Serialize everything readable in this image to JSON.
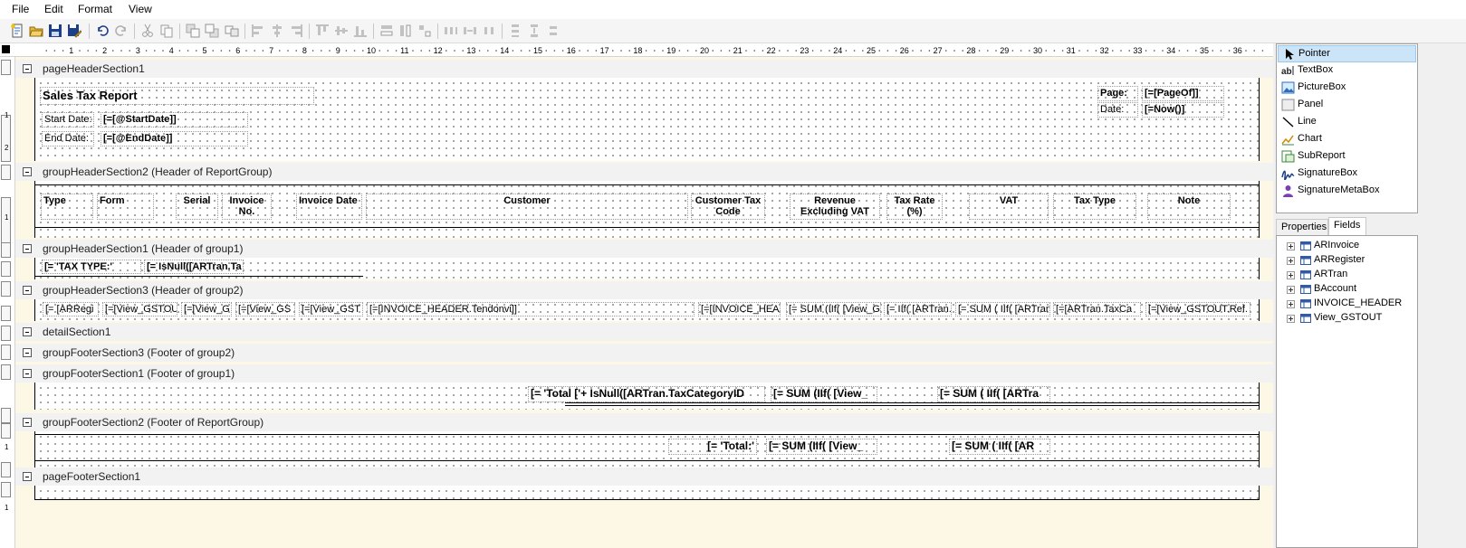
{
  "menu": [
    "File",
    "Edit",
    "Format",
    "View"
  ],
  "toolbar_icons": [
    "new-report-icon",
    "open-folder-icon",
    "save-icon",
    "save-as-icon",
    "undo-icon",
    "redo-icon",
    "cut-icon",
    "copy-icon",
    "bring-to-front-icon",
    "send-to-back-icon",
    "group-icon",
    "align-left-icon",
    "align-center-icon",
    "align-right-icon",
    "align-top-icon",
    "align-middle-icon",
    "align-bottom-icon",
    "same-width-icon",
    "same-height-icon",
    "same-size-icon",
    "horizontal-spacing-equal-icon",
    "horizontal-spacing-increase-icon",
    "horizontal-spacing-decrease-icon",
    "vertical-spacing-equal-icon",
    "vertical-spacing-increase-icon",
    "vertical-spacing-decrease-icon"
  ],
  "ruler": {
    "h_marks": [
      "1",
      "2",
      "3",
      "4",
      "5",
      "6",
      "7",
      "8",
      "9",
      "10",
      "11",
      "12",
      "13",
      "14",
      "15",
      "16",
      "17",
      "18",
      "19",
      "20",
      "21",
      "22",
      "23",
      "24",
      "25",
      "26",
      "27",
      "28",
      "29",
      "30",
      "31",
      "32",
      "33",
      "34",
      "35",
      "36"
    ],
    "v_marks": [
      "1",
      "2",
      "1",
      "1",
      "1"
    ]
  },
  "bands": {
    "page_header": "pageHeaderSection1",
    "group_header_2": "groupHeaderSection2 (Header of ReportGroup)",
    "group_header_1": "groupHeaderSection1 (Header of group1)",
    "group_header_3": "groupHeaderSection3 (Header of group2)",
    "detail": "detailSection1",
    "group_footer_3": "groupFooterSection3 (Footer of group2)",
    "group_footer_1": "groupFooterSection1 (Footer of group1)",
    "group_footer_2": "groupFooterSection2 (Footer of ReportGroup)",
    "page_footer": "pageFooterSection1"
  },
  "page_header": {
    "title": "Sales Tax Report",
    "start_label": "Start Date:",
    "start_value": "[=[@StartDate]]",
    "end_label": "End Date:",
    "end_value": "[=[@EndDate]]",
    "page_label": "Page:",
    "page_value": "[=[PageOf]]",
    "date_label": "Date:",
    "date_value": "[=Now()]"
  },
  "columns": {
    "type": "Type",
    "form": "Form",
    "serial": "Serial",
    "invoice_no_1": "Invoice",
    "invoice_no_2": "No.",
    "invoice_date": "Invoice Date",
    "customer": "Customer",
    "customer_tax_1": "Customer Tax",
    "customer_tax_2": "Code",
    "revenue_1": "Revenue",
    "revenue_2": "Excluding VAT",
    "tax_rate_1": "Tax Rate",
    "tax_rate_2": "(%)",
    "vat": "VAT",
    "tax_type": "Tax Type",
    "note": "Note"
  },
  "group1_header": {
    "tax_type": "[= 'TAX TYPE:'",
    "isnull": "[= IsNull([ARTran.Ta"
  },
  "group2_header_fields": [
    "[= [ARRegi",
    "[=[View_GSTOU",
    "[=[View_G",
    "[=[View_GS",
    "[=[View_GST",
    "[=[INVOICE_HEADER.Tendonvi]]",
    "[=[INVOICE_HEA",
    "[= SUM (IIf( [View_G",
    "[= IIf( [ARTran.",
    "[= SUM ( IIf( [ARTran",
    "[=[ARTran.TaxCa",
    "[=[View_GSTOUT.Ref."
  ],
  "group1_footer": {
    "total": "[= 'Total ['+ IsNull([ARTran.TaxCategoryID",
    "sum1": "[= SUM (IIf(  [View_",
    "sum2": "[= SUM ( IIf(  [ARTra"
  },
  "group2_footer": {
    "total": "[= 'Total:'",
    "sum1": "[= SUM (IIf(  [View_",
    "sum2": "[= SUM ( IIf(  [AR"
  },
  "toolbox": [
    {
      "label": "Pointer",
      "icon": "pointer-icon",
      "selected": true
    },
    {
      "label": "TextBox",
      "icon": "textbox-icon",
      "selected": false
    },
    {
      "label": "PictureBox",
      "icon": "picturebox-icon",
      "selected": false
    },
    {
      "label": "Panel",
      "icon": "panel-icon",
      "selected": false
    },
    {
      "label": "Line",
      "icon": "line-icon",
      "selected": false
    },
    {
      "label": "Chart",
      "icon": "chart-icon",
      "selected": false
    },
    {
      "label": "SubReport",
      "icon": "subreport-icon",
      "selected": false
    },
    {
      "label": "SignatureBox",
      "icon": "signaturebox-icon",
      "selected": false
    },
    {
      "label": "SignatureMetaBox",
      "icon": "signaturemetabox-icon",
      "selected": false
    }
  ],
  "tabs": {
    "properties": "Properties",
    "fields": "Fields",
    "active": "Fields"
  },
  "fields": [
    "ARInvoice",
    "ARRegister",
    "ARTran",
    "BAccount",
    "INVOICE_HEADER",
    "View_GSTOUT"
  ],
  "colors": {
    "band_background": "#fdf8e6",
    "selection": "#cce4f7",
    "dot_grid": "#7a7a7a"
  }
}
